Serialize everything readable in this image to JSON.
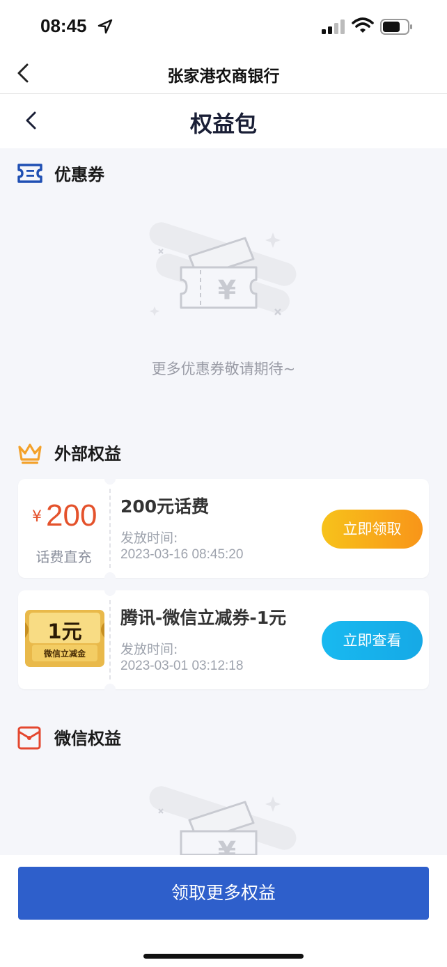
{
  "status_bar": {
    "time": "08:45"
  },
  "app_bar": {
    "title": "张家港农商银行"
  },
  "nav": {
    "title": "权益包"
  },
  "coupons_section": {
    "title": "优惠券",
    "empty_text": "更多优惠券敬请期待~"
  },
  "external_section": {
    "title": "外部权益",
    "items": [
      {
        "currency": "¥",
        "amount": "200",
        "subtitle": "话费直充",
        "title": "200元话费",
        "issue_label": "发放时间:",
        "issue_time": "2023-03-16 08:45:20",
        "button": "立即领取"
      },
      {
        "thumb_amount": "1元",
        "thumb_label": "微信立减金",
        "title": "腾讯-微信立减券-1元",
        "issue_label": "发放时间:",
        "issue_time": "2023-03-01 03:12:18",
        "button": "立即查看"
      }
    ]
  },
  "wechat_section": {
    "title": "微信权益"
  },
  "bottom": {
    "button": "领取更多权益"
  },
  "colors": {
    "accent_blue": "#2e5fcb",
    "price_red": "#e4522c",
    "orange": "#f89519",
    "cyan": "#18b9f0"
  }
}
